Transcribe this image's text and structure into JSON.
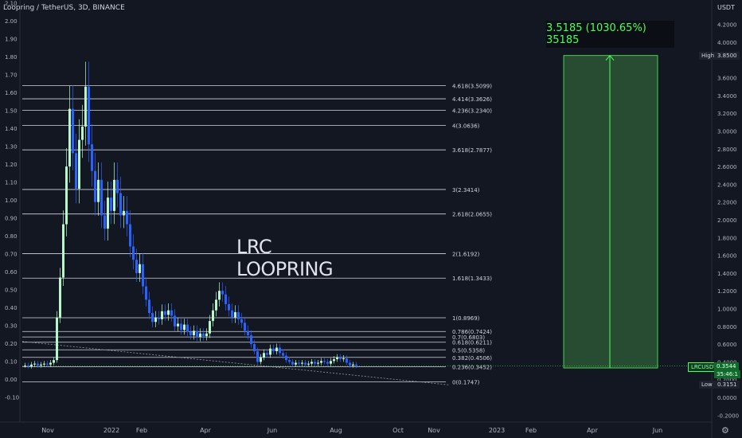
{
  "header": {
    "symbol_title": "Loopring / TetherUS, 3D, BINANCE"
  },
  "overlay": {
    "line1": "LRC",
    "line2": "LOOPRING"
  },
  "measure": {
    "text": "3.5185 (1030.65%) 35185"
  },
  "right_axis": {
    "unit": "USDT",
    "ticks": [
      "4.2000",
      "4.0000",
      "3.6000",
      "3.4000",
      "3.2000",
      "3.0000",
      "2.8000",
      "2.6000",
      "2.4000",
      "2.2000",
      "2.0000",
      "1.8000",
      "1.6000",
      "1.4000",
      "1.2000",
      "1.0000",
      "0.8000",
      "0.6000",
      "0.4000",
      "0.2000",
      "0.0000",
      "-0.2000"
    ],
    "tick_values": [
      4.2,
      4.0,
      3.6,
      3.4,
      3.2,
      3.0,
      2.8,
      2.6,
      2.4,
      2.2,
      2.0,
      1.8,
      1.6,
      1.4,
      1.2,
      1.0,
      0.8,
      0.6,
      0.4,
      0.2,
      0.0,
      -0.2
    ],
    "high_label": "High",
    "high_value": "3.8500",
    "symbol_badge": "LRCUSDT",
    "symbol_price": "0.3544",
    "symbol_countdown": "35:46:1",
    "low_label": "Low",
    "low_value": "0.3151"
  },
  "left_axis": {
    "ticks": [
      "2.10",
      "2.00",
      "1.90",
      "1.80",
      "1.70",
      "1.60",
      "1.50",
      "1.40",
      "1.30",
      "1.20",
      "1.10",
      "1.00",
      "0.90",
      "0.80",
      "0.70",
      "0.60",
      "0.50",
      "0.40",
      "0.30",
      "0.20",
      "0.10",
      "0.00",
      "-0.10"
    ],
    "tick_values": [
      2.1,
      2.0,
      1.9,
      1.8,
      1.7,
      1.6,
      1.5,
      1.4,
      1.3,
      1.2,
      1.1,
      1.0,
      0.9,
      0.8,
      0.7,
      0.6,
      0.5,
      0.4,
      0.3,
      0.2,
      0.1,
      0.0,
      -0.1
    ]
  },
  "time_axis": {
    "labels": [
      "Nov",
      "2022",
      "Feb",
      "Apr",
      "Jun",
      "Aug",
      "Oct",
      "Nov",
      "2023",
      "Feb",
      "Apr",
      "Jun"
    ]
  },
  "fib_levels": [
    {
      "label": "4.618(3.5099)",
      "value": 3.5099
    },
    {
      "label": "4.414(3.3626)",
      "value": 3.3626
    },
    {
      "label": "4.236(3.2340)",
      "value": 3.234
    },
    {
      "label": "4(3.0636)",
      "value": 3.0636
    },
    {
      "label": "3.618(2.7877)",
      "value": 2.7877
    },
    {
      "label": "3(2.3414)",
      "value": 2.3414
    },
    {
      "label": "2.618(2.0655)",
      "value": 2.0655
    },
    {
      "label": "2(1.6192)",
      "value": 1.6192
    },
    {
      "label": "1.618(1.3433)",
      "value": 1.3433
    },
    {
      "label": "1(0.8969)",
      "value": 0.8969
    },
    {
      "label": "0.786(0.7424)",
      "value": 0.7424
    },
    {
      "label": "0.7(0.6803)",
      "value": 0.6803
    },
    {
      "label": "0.618(0.6211)",
      "value": 0.6211
    },
    {
      "label": "0.5(0.5358)",
      "value": 0.5358
    },
    {
      "label": "0.382(0.4506)",
      "value": 0.4506
    },
    {
      "label": "0.236(0.3452)",
      "value": 0.3452
    },
    {
      "label": "0(0.1747)",
      "value": 0.1747
    }
  ],
  "chart_data": {
    "type": "candlestick",
    "symbol": "LRCUSDT",
    "interval": "3D",
    "exchange": "BINANCE",
    "y_range": [
      -0.2,
      4.3
    ],
    "candles_close": [
      0.36,
      0.35,
      0.37,
      0.38,
      0.36,
      0.37,
      0.38,
      0.37,
      0.39,
      0.42,
      0.9,
      1.35,
      1.95,
      2.6,
      3.25,
      2.75,
      2.35,
      2.9,
      3.05,
      3.5,
      2.85,
      2.55,
      2.2,
      2.45,
      2.05,
      1.9,
      2.25,
      2.1,
      2.45,
      2.3,
      2.05,
      2.1,
      1.95,
      1.7,
      1.55,
      1.4,
      1.5,
      1.25,
      1.1,
      0.95,
      0.85,
      0.9,
      0.88,
      0.97,
      0.93,
      0.98,
      0.92,
      0.8,
      0.83,
      0.76,
      0.82,
      0.74,
      0.7,
      0.75,
      0.68,
      0.72,
      0.69,
      0.72,
      0.86,
      0.98,
      1.1,
      1.2,
      1.16,
      1.05,
      0.98,
      0.9,
      0.96,
      0.88,
      0.84,
      0.75,
      0.7,
      0.6,
      0.52,
      0.4,
      0.45,
      0.5,
      0.48,
      0.55,
      0.52,
      0.56,
      0.5,
      0.47,
      0.42,
      0.4,
      0.37,
      0.39,
      0.38,
      0.39,
      0.37,
      0.38,
      0.4,
      0.38,
      0.39,
      0.41,
      0.4,
      0.38,
      0.41,
      0.43,
      0.45,
      0.43,
      0.44,
      0.39,
      0.36,
      0.37,
      0.355
    ],
    "measure": {
      "from": 0.3315,
      "to": 3.85,
      "change": 3.5185,
      "percent": 1030.65,
      "ticks": 35185
    },
    "high": 3.85,
    "low": 0.3151,
    "last_price": 0.3544
  },
  "colors": {
    "up": "#2962ff",
    "up_fill": "#b9f6ca",
    "bg": "#131722",
    "fib": "#d1d4dc",
    "measure": "#4cff5a"
  }
}
